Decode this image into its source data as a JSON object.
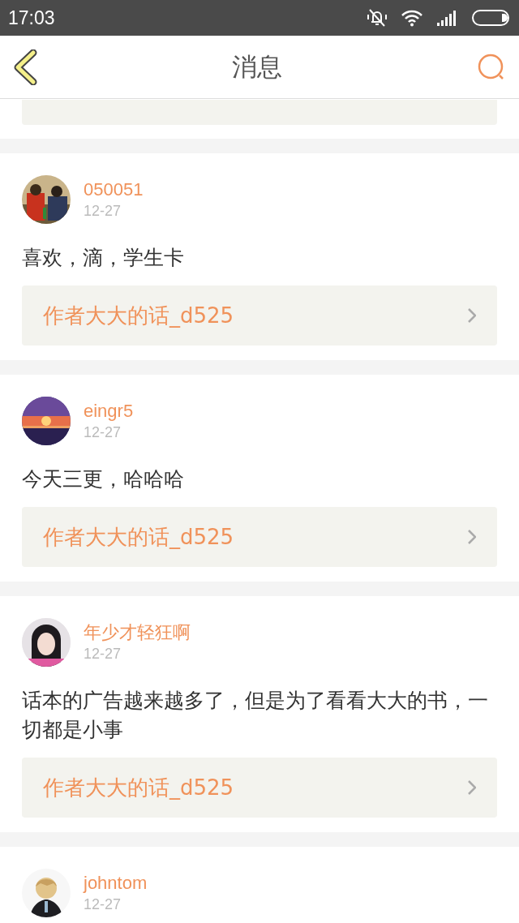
{
  "status_bar": {
    "time": "17:03"
  },
  "header": {
    "title": "消息"
  },
  "partial_item": {
    "kind": "cut_link_row"
  },
  "messages": [
    {
      "user": "050051",
      "date": "12-27",
      "text": "喜欢，滴，学生卡",
      "link": "作者大大的话_d525"
    },
    {
      "user": "eingr5",
      "date": "12-27",
      "text": "今天三更，哈哈哈",
      "link": "作者大大的话_d525"
    },
    {
      "user": "年少才轻狂啊",
      "date": "12-27",
      "text": "话本的广告越来越多了，但是为了看看大大的书，一切都是小事",
      "link": "作者大大的话_d525"
    },
    {
      "user": "johntom",
      "date": "12-27"
    }
  ]
}
